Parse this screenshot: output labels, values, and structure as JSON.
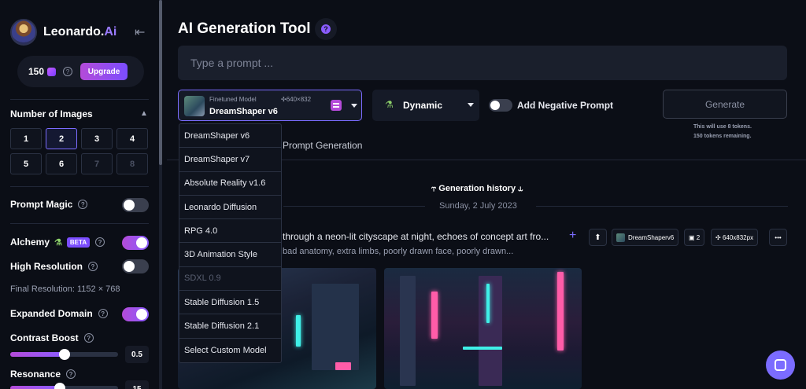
{
  "brand": {
    "name": "Leonardo.",
    "name_ai": "Ai"
  },
  "tokens": {
    "count": "150",
    "upgrade_label": "Upgrade"
  },
  "sidebar": {
    "number_of_images": {
      "title": "Number of Images",
      "options": [
        "1",
        "2",
        "3",
        "4",
        "5",
        "6",
        "7",
        "8"
      ],
      "selected": "2",
      "disabled": [
        "7",
        "8"
      ]
    },
    "prompt_magic": {
      "label": "Prompt Magic",
      "on": false
    },
    "alchemy": {
      "label": "Alchemy",
      "badge": "BETA",
      "on": true
    },
    "high_resolution": {
      "label": "High Resolution",
      "on": false
    },
    "final_resolution": "Final Resolution: 1152 × 768",
    "expanded_domain": {
      "label": "Expanded Domain",
      "on": true
    },
    "contrast_boost": {
      "label": "Contrast Boost",
      "value": "0.5",
      "fraction": 0.5
    },
    "resonance": {
      "label": "Resonance",
      "value": "15",
      "fraction": 0.46
    }
  },
  "main": {
    "title": "AI Generation Tool",
    "prompt_placeholder": "Type a prompt ...",
    "model": {
      "caption": "Finetuned Model",
      "dims": "640×832",
      "name": "DreamShaper v6"
    },
    "style": {
      "label": "Dynamic"
    },
    "negative_prompt_label": "Add Negative Prompt",
    "generate_label": "Generate",
    "gen_note_1": "This will use 8 tokens.",
    "gen_note_2": "150 tokens remaining.",
    "tab_prompt_generation": "Prompt Generation",
    "history_title": "Generation history",
    "history_date": "Sunday, 2 July 2023",
    "generation": {
      "prompt": "through a neon-lit cityscape at night, echoes of concept art fro...",
      "negative": "bad anatomy, extra limbs, poorly drawn face, poorly drawn...",
      "model_chip": "DreamShaperv6",
      "count_chip": "2",
      "dims_chip": "640x832px"
    }
  },
  "model_dropdown": [
    "DreamShaper v6",
    "DreamShaper v7",
    "Absolute Reality v1.6",
    "Leonardo Diffusion",
    "RPG 4.0",
    "3D Animation Style",
    "SDXL 0.9",
    "Stable Diffusion 1.5",
    "Stable Diffusion 2.1",
    "Select Custom Model"
  ],
  "model_dropdown_disabled_index": 6
}
